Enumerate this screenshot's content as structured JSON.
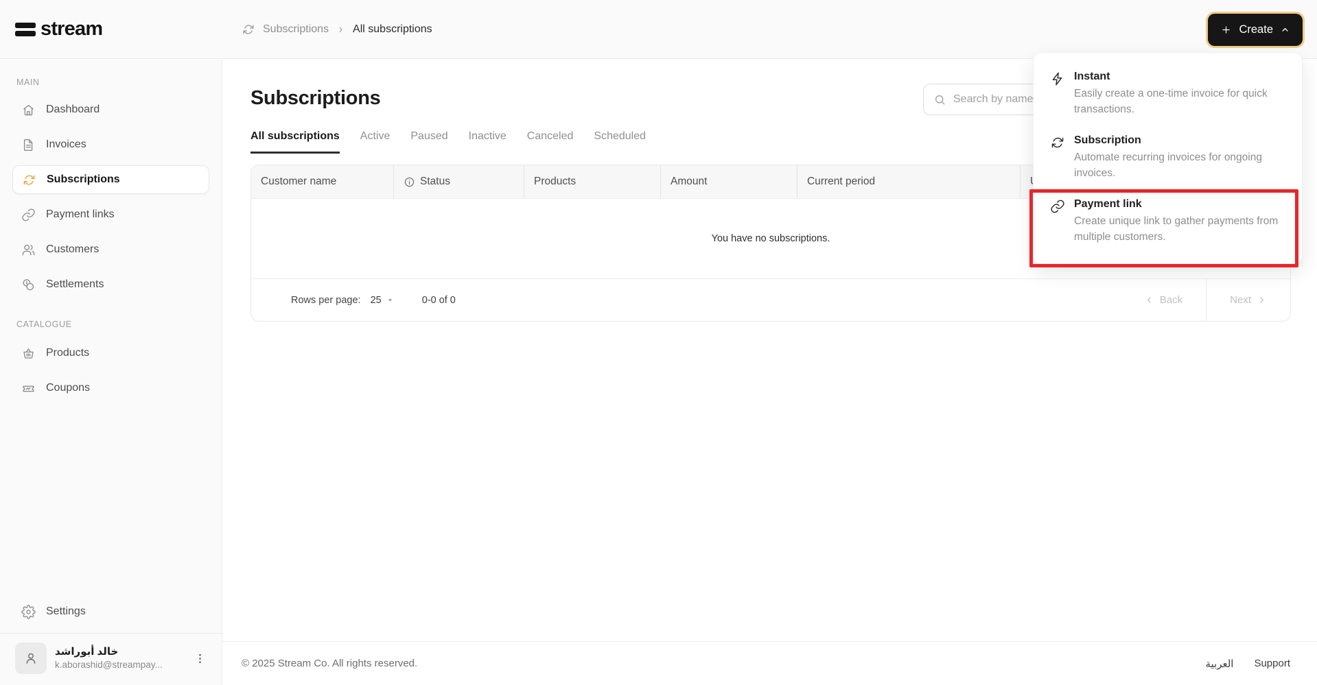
{
  "brand": {
    "name": "stream"
  },
  "breadcrumb": {
    "section": "Subscriptions",
    "current": "All subscriptions"
  },
  "create_button": {
    "label": "Create"
  },
  "create_menu": {
    "items": [
      {
        "icon": "lightning-icon",
        "title": "Instant",
        "description": "Easily create a one-time invoice for quick transactions.",
        "highlighted": false
      },
      {
        "icon": "sync-icon",
        "title": "Subscription",
        "description": "Automate recurring invoices for ongoing invoices.",
        "highlighted": false
      },
      {
        "icon": "link-icon",
        "title": "Payment link",
        "description": "Create unique link to gather payments from multiple customers.",
        "highlighted": true
      }
    ]
  },
  "sidebar": {
    "sections": [
      {
        "label": "MAIN",
        "items": [
          {
            "icon": "home-icon",
            "label": "Dashboard",
            "active": false
          },
          {
            "icon": "invoice-icon",
            "label": "Invoices",
            "active": false
          },
          {
            "icon": "sync-icon",
            "label": "Subscriptions",
            "active": true
          },
          {
            "icon": "link-icon",
            "label": "Payment links",
            "active": false
          },
          {
            "icon": "customers-icon",
            "label": "Customers",
            "active": false
          },
          {
            "icon": "coins-icon",
            "label": "Settlements",
            "active": false
          }
        ]
      },
      {
        "label": "CATALOGUE",
        "items": [
          {
            "icon": "basket-icon",
            "label": "Products",
            "active": false
          },
          {
            "icon": "ticket-icon",
            "label": "Coupons",
            "active": false
          }
        ]
      }
    ],
    "settings_label": "Settings",
    "user": {
      "name": "خالد أبوراشد",
      "email": "k.aborashid@streampay..."
    }
  },
  "main": {
    "title": "Subscriptions",
    "search_placeholder": "Search by name",
    "tabs": [
      {
        "label": "All subscriptions",
        "active": true
      },
      {
        "label": "Active",
        "active": false
      },
      {
        "label": "Paused",
        "active": false
      },
      {
        "label": "Inactive",
        "active": false
      },
      {
        "label": "Canceled",
        "active": false
      },
      {
        "label": "Scheduled",
        "active": false
      }
    ],
    "table": {
      "columns": [
        {
          "label": "Customer name",
          "info": false
        },
        {
          "label": "Status",
          "info": true
        },
        {
          "label": "Products",
          "info": false
        },
        {
          "label": "Amount",
          "info": false
        },
        {
          "label": "Current period",
          "info": false
        },
        {
          "label": "U",
          "info": false
        }
      ],
      "empty_message": "You have no subscriptions.",
      "pagination": {
        "rows_per_page_label": "Rows per page:",
        "rows_per_page_value": "25",
        "range_text": "0-0 of 0",
        "back_label": "Back",
        "next_label": "Next"
      }
    }
  },
  "footer": {
    "copyright": "© 2025 Stream Co. All rights reserved.",
    "language_link": "العربية",
    "support_link": "Support"
  },
  "colors": {
    "accent_amber": "#E7A33C",
    "annotation_red": "#E8262A",
    "button_black": "#161616",
    "surface_gray": "#FAFAFA"
  }
}
